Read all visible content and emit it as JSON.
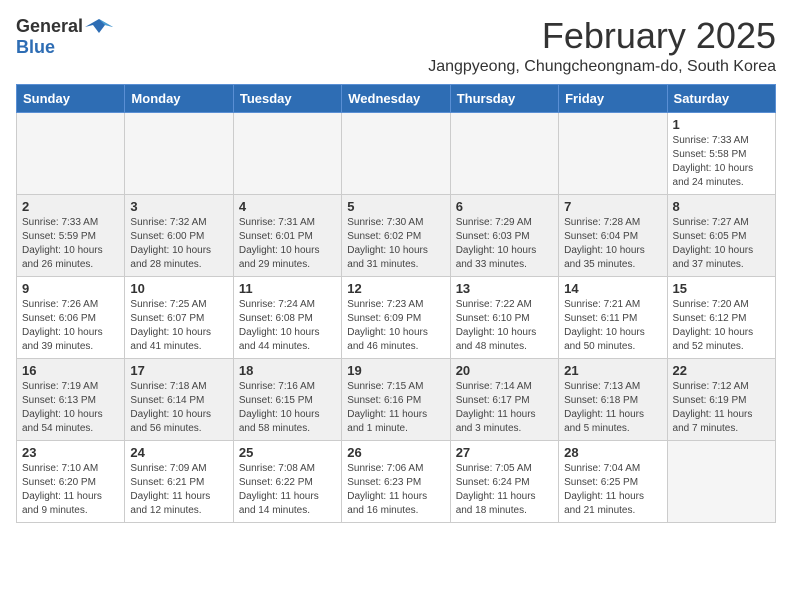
{
  "header": {
    "logo_general": "General",
    "logo_blue": "Blue",
    "title": "February 2025",
    "subtitle": "Jangpyeong, Chungcheongnam-do, South Korea"
  },
  "weekdays": [
    "Sunday",
    "Monday",
    "Tuesday",
    "Wednesday",
    "Thursday",
    "Friday",
    "Saturday"
  ],
  "weeks": [
    [
      {
        "day": "",
        "info": ""
      },
      {
        "day": "",
        "info": ""
      },
      {
        "day": "",
        "info": ""
      },
      {
        "day": "",
        "info": ""
      },
      {
        "day": "",
        "info": ""
      },
      {
        "day": "",
        "info": ""
      },
      {
        "day": "1",
        "info": "Sunrise: 7:33 AM\nSunset: 5:58 PM\nDaylight: 10 hours\nand 24 minutes."
      }
    ],
    [
      {
        "day": "2",
        "info": "Sunrise: 7:33 AM\nSunset: 5:59 PM\nDaylight: 10 hours\nand 26 minutes."
      },
      {
        "day": "3",
        "info": "Sunrise: 7:32 AM\nSunset: 6:00 PM\nDaylight: 10 hours\nand 28 minutes."
      },
      {
        "day": "4",
        "info": "Sunrise: 7:31 AM\nSunset: 6:01 PM\nDaylight: 10 hours\nand 29 minutes."
      },
      {
        "day": "5",
        "info": "Sunrise: 7:30 AM\nSunset: 6:02 PM\nDaylight: 10 hours\nand 31 minutes."
      },
      {
        "day": "6",
        "info": "Sunrise: 7:29 AM\nSunset: 6:03 PM\nDaylight: 10 hours\nand 33 minutes."
      },
      {
        "day": "7",
        "info": "Sunrise: 7:28 AM\nSunset: 6:04 PM\nDaylight: 10 hours\nand 35 minutes."
      },
      {
        "day": "8",
        "info": "Sunrise: 7:27 AM\nSunset: 6:05 PM\nDaylight: 10 hours\nand 37 minutes."
      }
    ],
    [
      {
        "day": "9",
        "info": "Sunrise: 7:26 AM\nSunset: 6:06 PM\nDaylight: 10 hours\nand 39 minutes."
      },
      {
        "day": "10",
        "info": "Sunrise: 7:25 AM\nSunset: 6:07 PM\nDaylight: 10 hours\nand 41 minutes."
      },
      {
        "day": "11",
        "info": "Sunrise: 7:24 AM\nSunset: 6:08 PM\nDaylight: 10 hours\nand 44 minutes."
      },
      {
        "day": "12",
        "info": "Sunrise: 7:23 AM\nSunset: 6:09 PM\nDaylight: 10 hours\nand 46 minutes."
      },
      {
        "day": "13",
        "info": "Sunrise: 7:22 AM\nSunset: 6:10 PM\nDaylight: 10 hours\nand 48 minutes."
      },
      {
        "day": "14",
        "info": "Sunrise: 7:21 AM\nSunset: 6:11 PM\nDaylight: 10 hours\nand 50 minutes."
      },
      {
        "day": "15",
        "info": "Sunrise: 7:20 AM\nSunset: 6:12 PM\nDaylight: 10 hours\nand 52 minutes."
      }
    ],
    [
      {
        "day": "16",
        "info": "Sunrise: 7:19 AM\nSunset: 6:13 PM\nDaylight: 10 hours\nand 54 minutes."
      },
      {
        "day": "17",
        "info": "Sunrise: 7:18 AM\nSunset: 6:14 PM\nDaylight: 10 hours\nand 56 minutes."
      },
      {
        "day": "18",
        "info": "Sunrise: 7:16 AM\nSunset: 6:15 PM\nDaylight: 10 hours\nand 58 minutes."
      },
      {
        "day": "19",
        "info": "Sunrise: 7:15 AM\nSunset: 6:16 PM\nDaylight: 11 hours\nand 1 minute."
      },
      {
        "day": "20",
        "info": "Sunrise: 7:14 AM\nSunset: 6:17 PM\nDaylight: 11 hours\nand 3 minutes."
      },
      {
        "day": "21",
        "info": "Sunrise: 7:13 AM\nSunset: 6:18 PM\nDaylight: 11 hours\nand 5 minutes."
      },
      {
        "day": "22",
        "info": "Sunrise: 7:12 AM\nSunset: 6:19 PM\nDaylight: 11 hours\nand 7 minutes."
      }
    ],
    [
      {
        "day": "23",
        "info": "Sunrise: 7:10 AM\nSunset: 6:20 PM\nDaylight: 11 hours\nand 9 minutes."
      },
      {
        "day": "24",
        "info": "Sunrise: 7:09 AM\nSunset: 6:21 PM\nDaylight: 11 hours\nand 12 minutes."
      },
      {
        "day": "25",
        "info": "Sunrise: 7:08 AM\nSunset: 6:22 PM\nDaylight: 11 hours\nand 14 minutes."
      },
      {
        "day": "26",
        "info": "Sunrise: 7:06 AM\nSunset: 6:23 PM\nDaylight: 11 hours\nand 16 minutes."
      },
      {
        "day": "27",
        "info": "Sunrise: 7:05 AM\nSunset: 6:24 PM\nDaylight: 11 hours\nand 18 minutes."
      },
      {
        "day": "28",
        "info": "Sunrise: 7:04 AM\nSunset: 6:25 PM\nDaylight: 11 hours\nand 21 minutes."
      },
      {
        "day": "",
        "info": ""
      }
    ]
  ]
}
